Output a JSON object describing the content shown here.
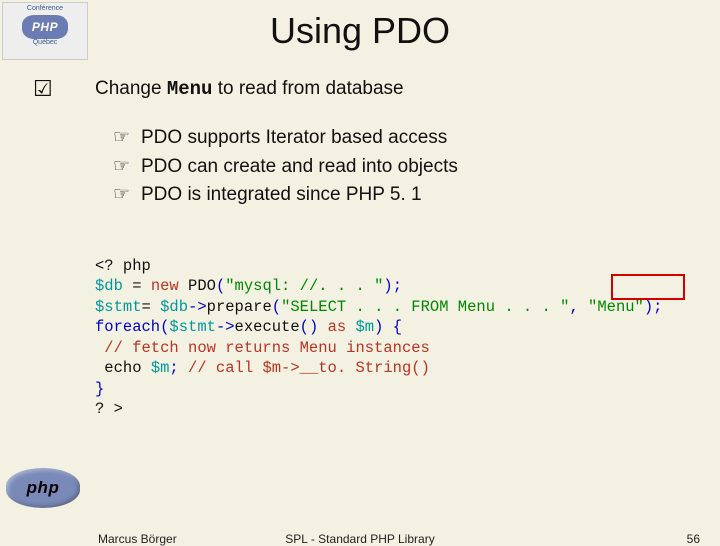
{
  "logos": {
    "top_label": "Conférence",
    "top_badge": "PHP",
    "top_sub": "Québec",
    "bottom": "php"
  },
  "title": "Using PDO",
  "heading": {
    "pre": "Change ",
    "mono": "Menu",
    "post": " to read from database"
  },
  "bullets": [
    "PDO supports Iterator based access",
    "PDO can create and read into objects",
    "PDO is integrated since PHP 5. 1"
  ],
  "code": {
    "l0a": "<? php",
    "l1a": "$db",
    "l1b": " = ",
    "l1c": "new",
    "l1d": " PDO",
    "l1e": "(",
    "l1f": "\"mysql: //. . . \"",
    "l1g": ");",
    "l2a": "$stmt",
    "l2b": "= ",
    "l2c": "$db",
    "l2d": "->",
    "l2e": "prepare",
    "l2f": "(",
    "l2g": "\"SELECT . . . FROM Menu . . . \"",
    "l2h": ", ",
    "l2i": "\"Menu\"",
    "l2j": ");",
    "l3a": "foreach(",
    "l3b": "$stmt",
    "l3c": "->",
    "l3d": "execute",
    "l3e": "() ",
    "l3f": "as ",
    "l3g": "$m",
    "l3h": ") {",
    "l4a": " // fetch now returns Menu instances",
    "l5a": " echo ",
    "l5b": "$m",
    "l5c": "; ",
    "l5d": "// call $m->__to. String()",
    "l6a": "}",
    "l7a": "? >"
  },
  "footer": {
    "left": "Marcus Börger",
    "mid": "SPL - Standard PHP Library",
    "right": "56"
  }
}
